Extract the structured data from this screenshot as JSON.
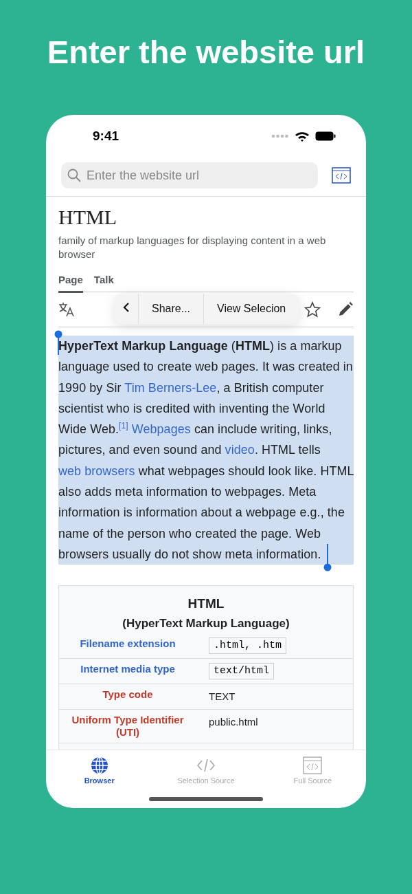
{
  "headline": "Enter the website url",
  "status_bar": {
    "time": "9:41"
  },
  "search": {
    "placeholder": "Enter the website url"
  },
  "article": {
    "title": "HTML",
    "description": "family of markup languages for displaying content in a web browser",
    "tabs": [
      {
        "label": "Page",
        "selected": true
      },
      {
        "label": "Talk",
        "selected": false
      }
    ],
    "selection_menu": {
      "items": [
        "Share...",
        "View Selecion"
      ]
    },
    "paragraph": [
      {
        "kind": "bold",
        "text": "HyperText Markup Language"
      },
      {
        "kind": "text",
        "text": " ("
      },
      {
        "kind": "bold",
        "text": "HTML"
      },
      {
        "kind": "text",
        "text": ") is a markup language used to create web pages. It was created in 1990 by Sir "
      },
      {
        "kind": "link",
        "text": "Tim Berners-Lee"
      },
      {
        "kind": "text",
        "text": ", a British computer scientist who is credited with inventing the World Wide Web.$^{[1]}$ "
      },
      {
        "kind": "link",
        "text": "Webpages"
      },
      {
        "kind": "text",
        "text": " can include writing, links, pictures, and even sound and "
      },
      {
        "kind": "link",
        "text": "video"
      },
      {
        "kind": "text",
        "text": ". HTML tells "
      },
      {
        "kind": "link",
        "text": "web browsers"
      },
      {
        "kind": "text",
        "text": " what webpages should look like. HTML also adds meta information to webpages. Meta information is information about a webpage e.g., the name of the person who created the page. Web browsers usually do not show meta information."
      }
    ],
    "infobox": {
      "title": "HTML",
      "subtitle": "(HyperText Markup Language)",
      "rows": [
        {
          "label": {
            "text": "Filename extension",
            "kind": "link"
          },
          "value": {
            "text": ".html, .htm",
            "kind": "code"
          }
        },
        {
          "label": {
            "text": "Internet media type",
            "kind": "link"
          },
          "value": {
            "text": "text/html",
            "kind": "code"
          }
        },
        {
          "label": {
            "text": "Type code",
            "kind": "missing"
          },
          "value": {
            "text": "TEXT",
            "kind": "text"
          }
        },
        {
          "label": {
            "text": "Uniform Type Identifier (UTI)",
            "kind": "missing"
          },
          "value": {
            "text": "public.html",
            "kind": "text"
          }
        }
      ]
    }
  },
  "tab_bar": [
    {
      "label": "Browser",
      "kind": "globe",
      "selected": true
    },
    {
      "label": "Selection Source",
      "kind": "code",
      "selected": false
    },
    {
      "label": "Full Source",
      "kind": "window",
      "selected": false
    }
  ]
}
